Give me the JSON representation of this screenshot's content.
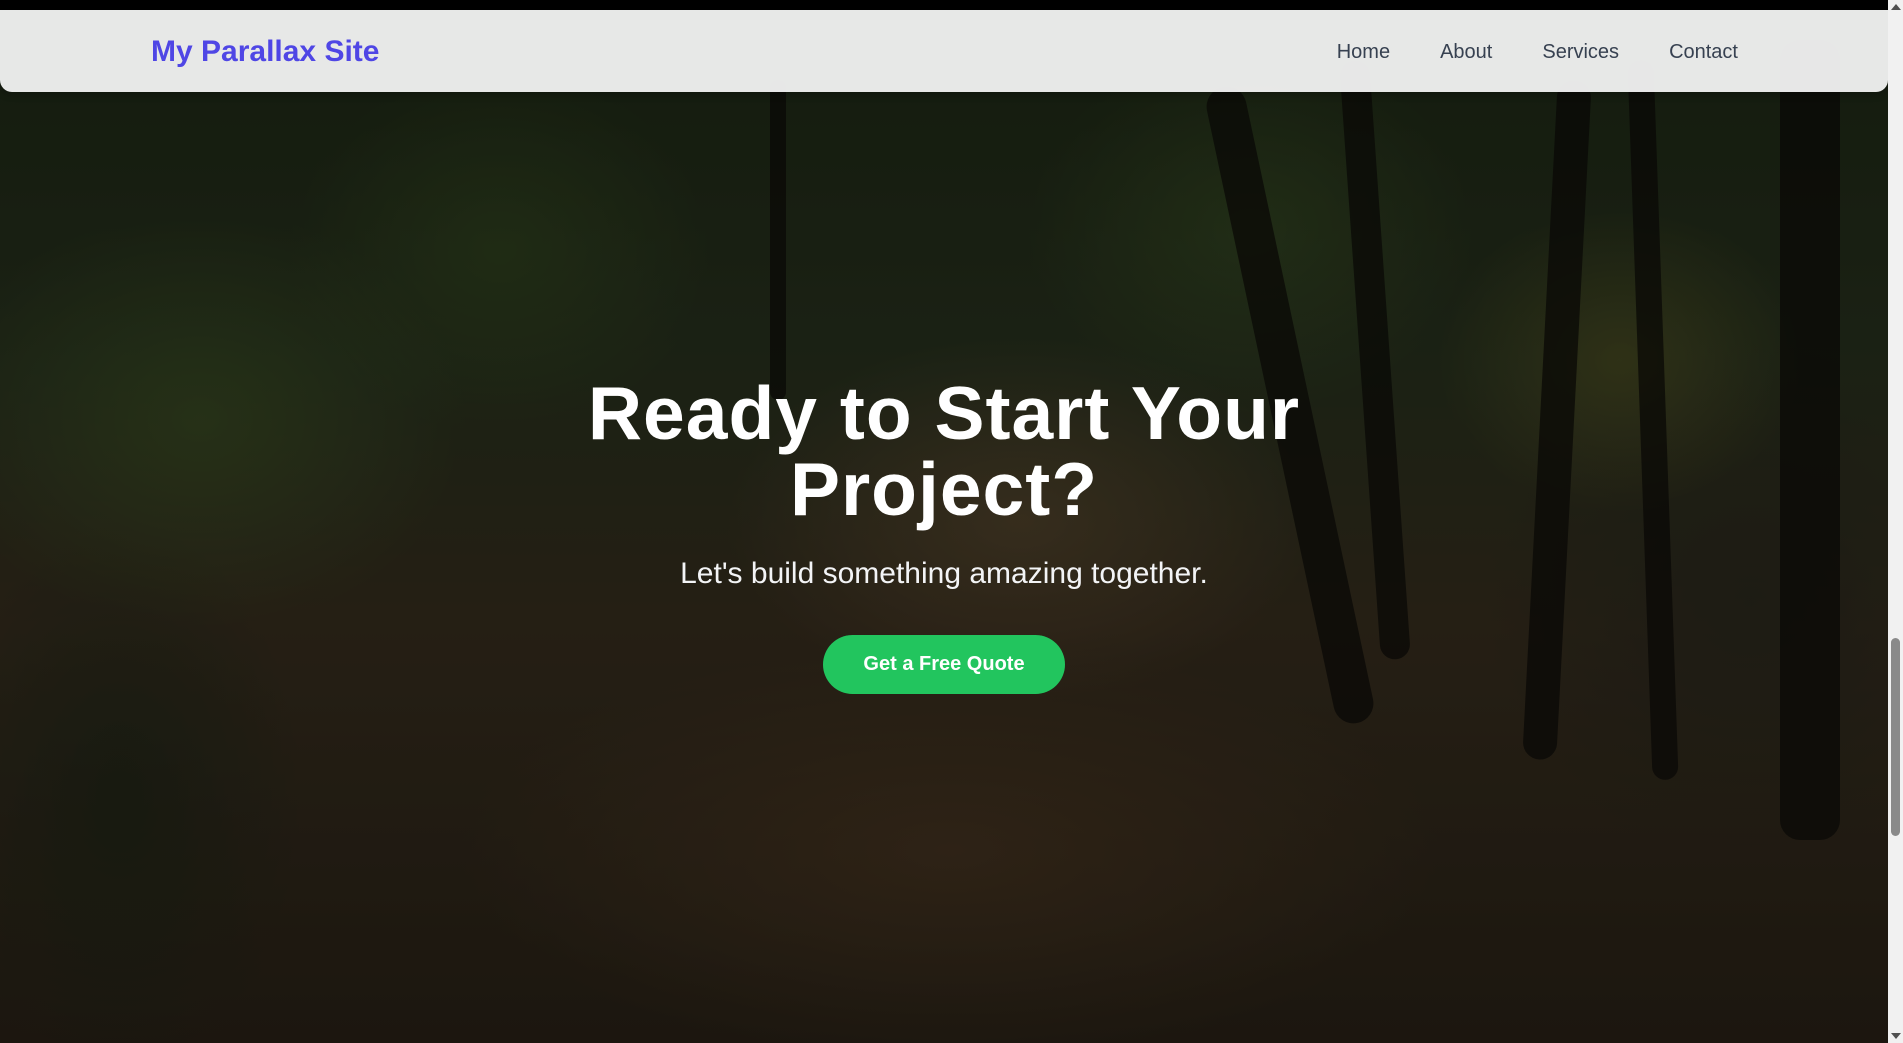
{
  "header": {
    "brand": "My Parallax Site",
    "nav": [
      {
        "label": "Home"
      },
      {
        "label": "About"
      },
      {
        "label": "Services"
      },
      {
        "label": "Contact"
      }
    ]
  },
  "hero": {
    "title": "Ready to Start Your Project?",
    "subtitle": "Let's build something amazing together.",
    "cta_label": "Get a Free Quote"
  },
  "colors": {
    "brand": "#4f46e5",
    "cta": "#22c55e",
    "nav_text": "#374151",
    "navbar_bg": "#f0f0f0"
  },
  "scrollbar": {
    "position_fraction": 0.75
  }
}
